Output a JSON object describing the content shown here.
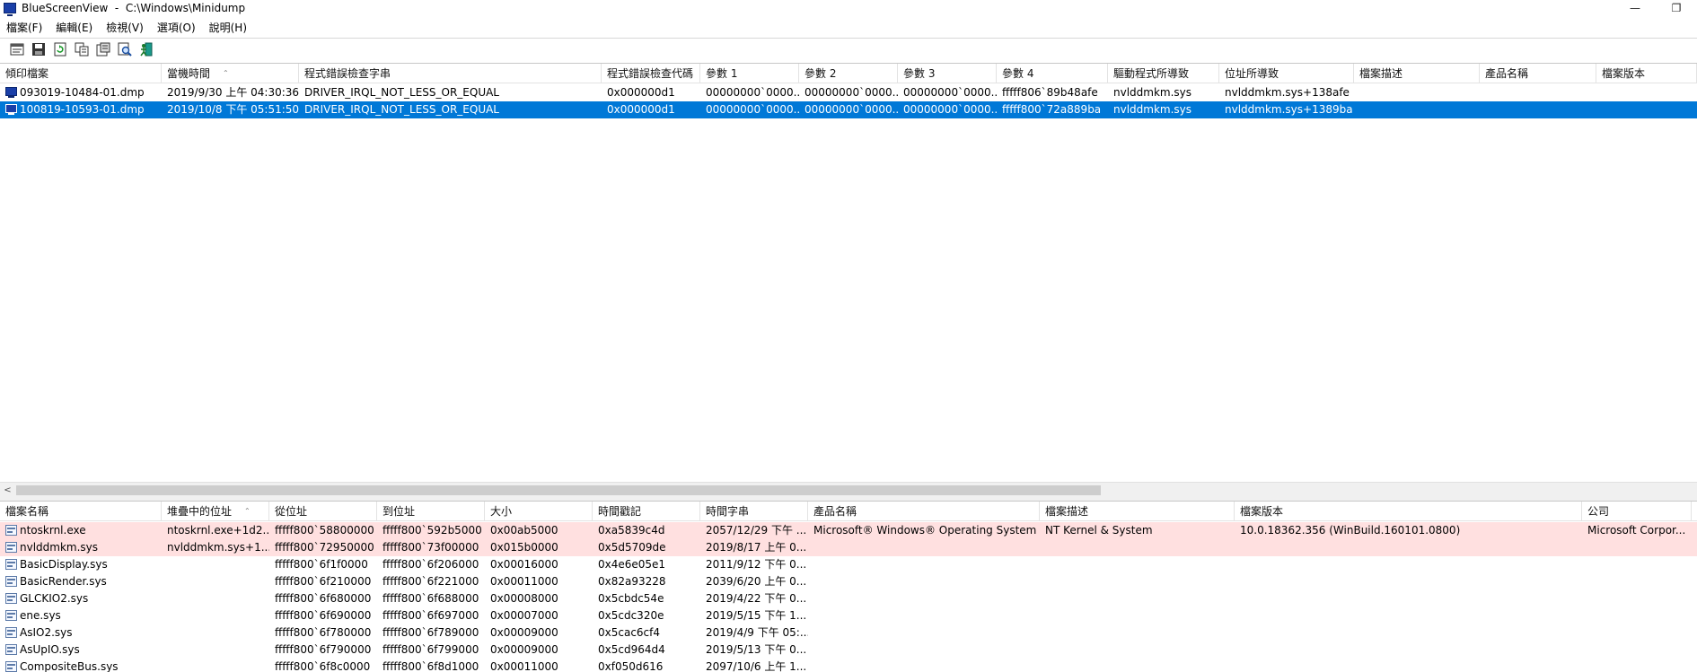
{
  "window": {
    "title": "BlueScreenView  -  C:\\Windows\\Minidump",
    "minimize_glyph": "—",
    "restore_glyph": "❐"
  },
  "menu": [
    {
      "label": "檔案(F)"
    },
    {
      "label": "編輯(E)"
    },
    {
      "label": "檢視(V)"
    },
    {
      "label": "選項(O)"
    },
    {
      "label": "說明(H)"
    }
  ],
  "toolbar_icons": [
    "properties-icon",
    "save-icon",
    "refresh-icon",
    "copy-icon",
    "html-report-icon",
    "find-icon",
    "exit-icon"
  ],
  "dump_list": {
    "headers": [
      "傾印檔案",
      "當機時間",
      "程式錯誤檢查字串",
      "程式錯誤檢查代碼",
      "參數 1",
      "參數 2",
      "參數 3",
      "參數 4",
      "驅動程式所導致",
      "位址所導致",
      "檔案描述",
      "產品名稱",
      "檔案版本"
    ],
    "rows": [
      {
        "cells": [
          "093019-10484-01.dmp",
          "2019/9/30 上午 04:30:36",
          "DRIVER_IRQL_NOT_LESS_OR_EQUAL",
          "0x000000d1",
          "00000000`0000...",
          "00000000`0000...",
          "00000000`0000...",
          "fffff806`89b48afe",
          "nvlddmkm.sys",
          "nvlddmkm.sys+138afe",
          "",
          "",
          ""
        ],
        "selected": false
      },
      {
        "cells": [
          "100819-10593-01.dmp",
          "2019/10/8 下午 05:51:50",
          "DRIVER_IRQL_NOT_LESS_OR_EQUAL",
          "0x000000d1",
          "00000000`0000...",
          "00000000`0000...",
          "00000000`0000...",
          "fffff800`72a889ba",
          "nvlddmkm.sys",
          "nvlddmkm.sys+1389ba",
          "",
          "",
          ""
        ],
        "selected": true
      }
    ]
  },
  "driver_list": {
    "headers": [
      "檔案名稱",
      "堆疊中的位址",
      "從位址",
      "到位址",
      "大小",
      "時間戳記",
      "時間字串",
      "產品名稱",
      "檔案描述",
      "檔案版本",
      "公司"
    ],
    "rows": [
      {
        "cells": [
          "ntoskrnl.exe",
          "ntoskrnl.exe+1d2...",
          "fffff800`58800000",
          "fffff800`592b5000",
          "0x00ab5000",
          "0xa5839c4d",
          "2057/12/29 下午 ...",
          "Microsoft® Windows® Operating System",
          "NT Kernel & System",
          "10.0.18362.356 (WinBuild.160101.0800)",
          "Microsoft Corpor..."
        ],
        "highlight": true
      },
      {
        "cells": [
          "nvlddmkm.sys",
          "nvlddmkm.sys+1...",
          "fffff800`72950000",
          "fffff800`73f00000",
          "0x015b0000",
          "0x5d5709de",
          "2019/8/17 上午 0...",
          "",
          "",
          "",
          ""
        ],
        "highlight": true
      },
      {
        "cells": [
          "BasicDisplay.sys",
          "",
          "fffff800`6f1f0000",
          "fffff800`6f206000",
          "0x00016000",
          "0x4e6e05e1",
          "2011/9/12 下午 0...",
          "",
          "",
          "",
          ""
        ],
        "highlight": false
      },
      {
        "cells": [
          "BasicRender.sys",
          "",
          "fffff800`6f210000",
          "fffff800`6f221000",
          "0x00011000",
          "0x82a93228",
          "2039/6/20 上午 0...",
          "",
          "",
          "",
          ""
        ],
        "highlight": false
      },
      {
        "cells": [
          "GLCKIO2.sys",
          "",
          "fffff800`6f680000",
          "fffff800`6f688000",
          "0x00008000",
          "0x5cbdc54e",
          "2019/4/22 下午 0...",
          "",
          "",
          "",
          ""
        ],
        "highlight": false
      },
      {
        "cells": [
          "ene.sys",
          "",
          "fffff800`6f690000",
          "fffff800`6f697000",
          "0x00007000",
          "0x5cdc320e",
          "2019/5/15 下午 1...",
          "",
          "",
          "",
          ""
        ],
        "highlight": false
      },
      {
        "cells": [
          "AsIO2.sys",
          "",
          "fffff800`6f780000",
          "fffff800`6f789000",
          "0x00009000",
          "0x5cac6cf4",
          "2019/4/9 下午 05:...",
          "",
          "",
          "",
          ""
        ],
        "highlight": false
      },
      {
        "cells": [
          "AsUpIO.sys",
          "",
          "fffff800`6f790000",
          "fffff800`6f799000",
          "0x00009000",
          "0x5cd964d4",
          "2019/5/13 下午 0...",
          "",
          "",
          "",
          ""
        ],
        "highlight": false
      },
      {
        "cells": [
          "CompositeBus.sys",
          "",
          "fffff800`6f8c0000",
          "fffff800`6f8d1000",
          "0x00011000",
          "0xf050d616",
          "2097/10/6 上午 1...",
          "",
          "",
          "",
          ""
        ],
        "highlight": false
      }
    ]
  },
  "scrollbar": {
    "left_arrow": "<"
  },
  "colors": {
    "selection": "#0078d7",
    "highlight_row": "#ffe0e0"
  }
}
